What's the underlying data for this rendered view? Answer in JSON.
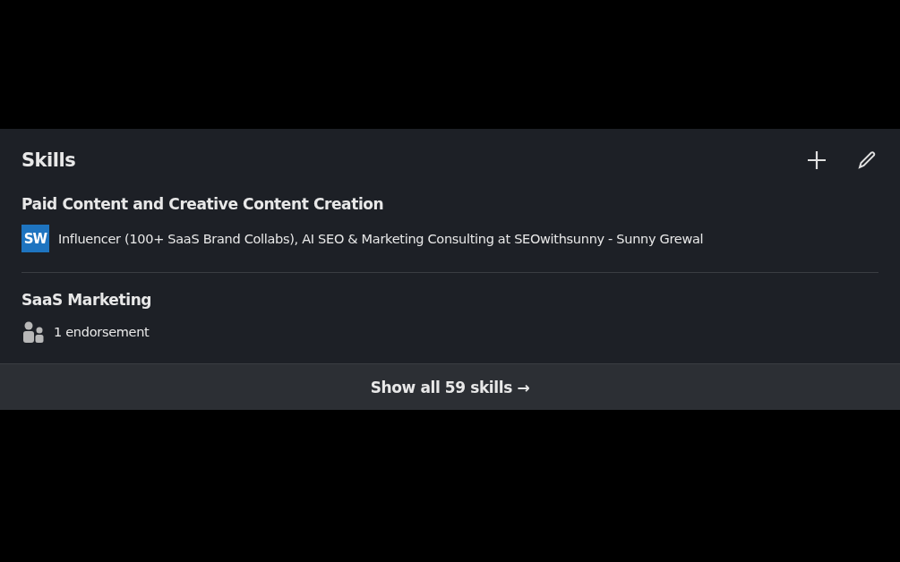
{
  "card": {
    "title": "Skills",
    "skills": [
      {
        "name": "Paid Content and Creative Content Creation",
        "detail": {
          "kind": "company",
          "logo": "SW",
          "text": "Influencer (100+ SaaS Brand Collabs), AI SEO & Marketing Consulting at SEOwithsunny - Sunny Grewal"
        }
      },
      {
        "name": "SaaS Marketing",
        "detail": {
          "kind": "endorsement",
          "text": "1 endorsement"
        }
      }
    ],
    "footer": {
      "label": "Show all 59 skills →"
    }
  }
}
